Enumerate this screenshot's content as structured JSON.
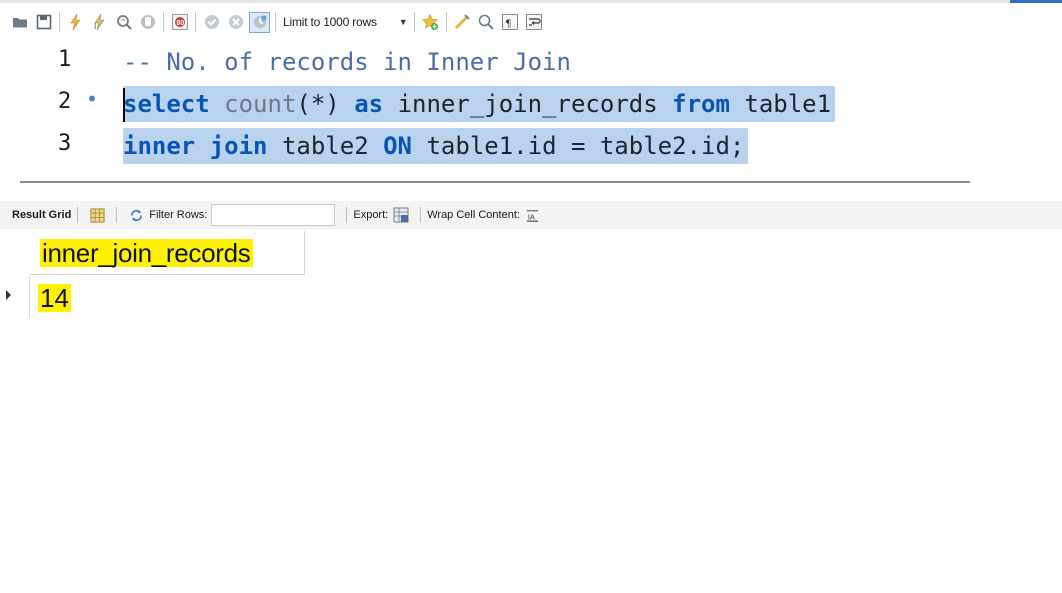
{
  "toolbar": {
    "limit_label": "Limit to 1000 rows",
    "icons": [
      "folder-open-icon",
      "save-icon",
      "execute-icon",
      "execute-current-icon",
      "explain-icon",
      "stop-icon",
      "toggle-error-icon",
      "commit-icon",
      "rollback-icon",
      "autocommit-icon",
      "limit-rows-select",
      "add-snippet-icon",
      "beautify-icon",
      "find-icon",
      "invisible-chars-icon",
      "wrap-lines-icon"
    ]
  },
  "editor": {
    "lines": [
      {
        "number": "1",
        "marker": ""
      },
      {
        "number": "2",
        "marker": "•"
      },
      {
        "number": "3",
        "marker": ""
      }
    ],
    "line1": {
      "comment": "-- No. of records in Inner Join"
    },
    "line2": {
      "kw_select": "select",
      "fn_count": "count",
      "paren": "(*)",
      "kw_as": "as",
      "alias": "inner_join_records",
      "kw_from": "from",
      "table": "table1"
    },
    "line3": {
      "kw_inner_join": "inner join",
      "table": "table2",
      "kw_on": "ON",
      "cond": "table1.id = table2.id;"
    }
  },
  "result_toolbar": {
    "result_grid_label": "Result Grid",
    "filter_rows_label": "Filter Rows:",
    "filter_value": "",
    "export_label": "Export:",
    "wrap_label": "Wrap Cell Content:"
  },
  "grid": {
    "columns": [
      "inner_join_records"
    ],
    "rows": [
      [
        "14"
      ]
    ]
  },
  "colors": {
    "highlight": "#fff200",
    "selection": "#b9d3ee",
    "keyword": "#0a55b3"
  }
}
